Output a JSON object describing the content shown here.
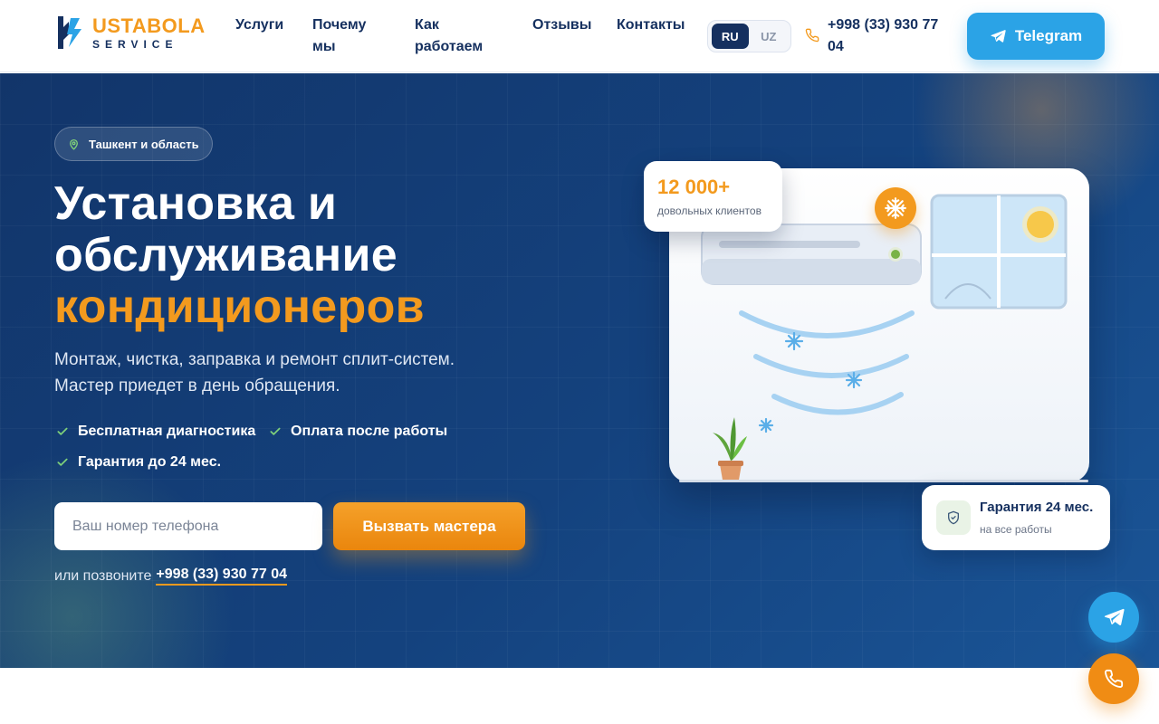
{
  "brand": {
    "name": "USTABOLA",
    "sub": "SERVICE"
  },
  "nav": [
    {
      "label": "Услуги"
    },
    {
      "label": "Почему мы"
    },
    {
      "label": "Как работаем"
    },
    {
      "label": "Отзывы"
    },
    {
      "label": "Контакты"
    }
  ],
  "lang": {
    "active": "RU",
    "inactive": "UZ"
  },
  "header": {
    "phone": "+998 (33) 930 77 04",
    "telegram_label": "Telegram"
  },
  "hero": {
    "location": "Ташкент и область",
    "title_line1": "Установка и",
    "title_line2": "обслуживание",
    "title_accent": "кондиционеров",
    "subtitle_line1": "Монтаж, чистка, заправка и ремонт сплит-систем.",
    "subtitle_line2": "Мастер приедет в день обращения.",
    "features": [
      "Бесплатная диагностика",
      "Оплата после работы",
      "Гарантия до 24 мес."
    ],
    "phone_placeholder": "Ваш номер телефона",
    "cta_label": "Вызвать мастера",
    "or_call": "или позвоните",
    "or_call_phone": "+998 (33) 930 77 04"
  },
  "stats": {
    "value": "12 000+",
    "label": "довольных клиентов"
  },
  "guarantee": {
    "title": "Гарантия 24 мес.",
    "sub": "на все работы"
  },
  "colors": {
    "accent": "#f39a1e",
    "navy": "#15305f",
    "telegram": "#2ba3e6",
    "hero_bg": "#14427e"
  },
  "icons": {
    "logo": "bolt-wrench-icon",
    "phone": "phone-icon",
    "telegram": "telegram-plane-icon",
    "location": "map-pin-icon",
    "check": "check-icon",
    "snowflake": "snowflake-icon",
    "shield": "shield-check-icon"
  }
}
